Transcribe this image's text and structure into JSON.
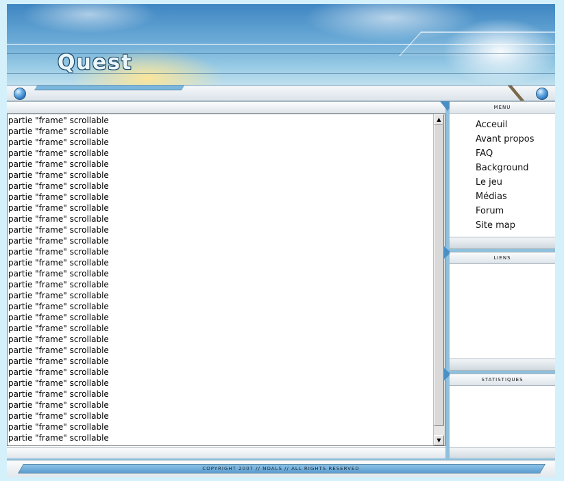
{
  "header": {
    "logo_text": "Quest"
  },
  "colors": {
    "accent": "#4a8fc4",
    "page_bg": "#d4f0fb"
  },
  "main": {
    "lines": [
      "partie \"frame\" scrollable",
      "partie \"frame\" scrollable",
      "partie \"frame\" scrollable",
      "partie \"frame\" scrollable",
      "partie \"frame\" scrollable",
      "partie \"frame\" scrollable",
      "partie \"frame\" scrollable",
      "partie \"frame\" scrollable",
      "partie \"frame\" scrollable",
      "partie \"frame\" scrollable",
      "partie \"frame\" scrollable",
      "partie \"frame\" scrollable",
      "partie \"frame\" scrollable",
      "partie \"frame\" scrollable",
      "partie \"frame\" scrollable",
      "partie \"frame\" scrollable",
      "partie \"frame\" scrollable",
      "partie \"frame\" scrollable",
      "partie \"frame\" scrollable",
      "partie \"frame\" scrollable",
      "partie \"frame\" scrollable",
      "partie \"frame\" scrollable",
      "partie \"frame\" scrollable",
      "partie \"frame\" scrollable",
      "partie \"frame\" scrollable",
      "partie \"frame\" scrollable",
      "partie \"frame\" scrollable",
      "partie \"frame\" scrollable",
      "partie \"frame\" scrollable",
      "partie \"frame\" scrollable",
      "partie \"frame\" scrollable"
    ],
    "scroll_up_glyph": "▲",
    "scroll_down_glyph": "▼"
  },
  "sidebar": {
    "menu": {
      "title": "Menu",
      "items": [
        "Acceuil",
        "Avant propos",
        "FAQ",
        "Background",
        "Le jeu",
        "Médias",
        "Forum",
        "Site map"
      ]
    },
    "links": {
      "title": "Liens"
    },
    "stats": {
      "title": "Statistiques"
    }
  },
  "footer": {
    "copyright": "Copyright 2007 // Noals // All rights reserved"
  }
}
